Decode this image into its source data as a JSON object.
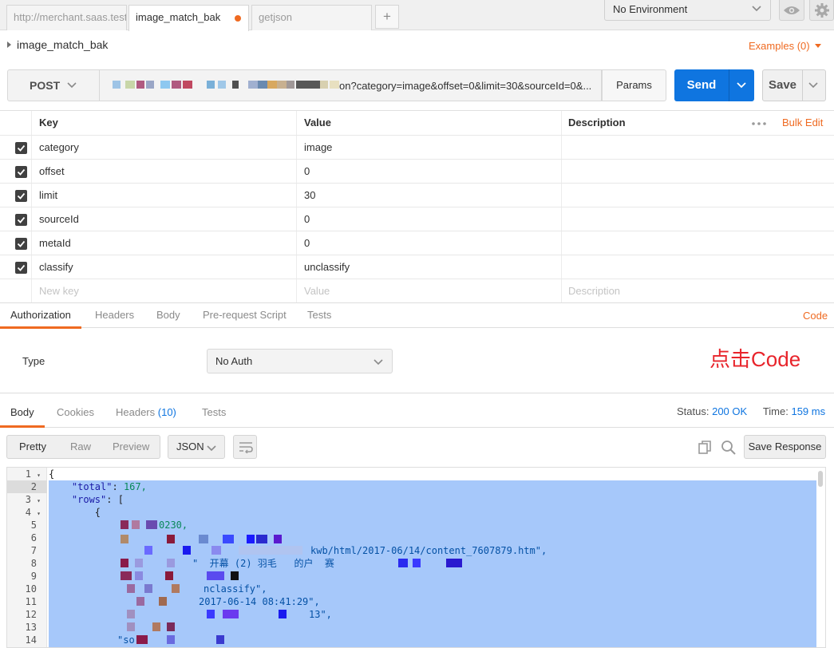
{
  "tabs": [
    {
      "label": "http://merchant.saas.test",
      "active": false
    },
    {
      "label": "image_match_bak",
      "active": true,
      "unsaved": true
    },
    {
      "label": "getjson",
      "active": false
    }
  ],
  "tab_add_label": "+",
  "environment": {
    "selected": "No Environment"
  },
  "request": {
    "name": "image_match_bak",
    "examples_label": "Examples (0)"
  },
  "url_bar": {
    "method": "POST",
    "url_visible_suffix": "on?category=image&offset=0&limit=30&sourceId=0&...",
    "params_label": "Params",
    "send_label": "Send",
    "save_label": "Save"
  },
  "params_table": {
    "headers": {
      "key": "Key",
      "value": "Value",
      "description": "Description"
    },
    "bulk_edit_label": "Bulk Edit",
    "rows": [
      {
        "key": "category",
        "value": "image",
        "description": ""
      },
      {
        "key": "offset",
        "value": "0",
        "description": ""
      },
      {
        "key": "limit",
        "value": "30",
        "description": ""
      },
      {
        "key": "sourceId",
        "value": "0",
        "description": ""
      },
      {
        "key": "metaId",
        "value": "0",
        "description": ""
      },
      {
        "key": "classify",
        "value": "unclassify",
        "description": ""
      }
    ],
    "new_row": {
      "key_placeholder": "New key",
      "value_placeholder": "Value",
      "description_placeholder": "Description"
    }
  },
  "request_tabs": [
    "Authorization",
    "Headers",
    "Body",
    "Pre-request Script",
    "Tests"
  ],
  "code_label": "Code",
  "auth": {
    "type_label": "Type",
    "type_value": "No Auth"
  },
  "annotation": "点击Code",
  "response": {
    "tabs": [
      "Body",
      "Cookies",
      "Headers",
      "Tests"
    ],
    "headers_count": "(10)",
    "status_label": "Status:",
    "status_value": "200 OK",
    "time_label": "Time:",
    "time_value": "159 ms",
    "view_modes": [
      "Pretty",
      "Raw",
      "Preview"
    ],
    "format": "JSON",
    "save_response_label": "Save Response",
    "line_numbers": [
      "1",
      "2",
      "3",
      "4",
      "5",
      "6",
      "7",
      "8",
      "9",
      "10",
      "11",
      "12",
      "13",
      "14"
    ],
    "code": {
      "l1": "{",
      "l2_key": "\"total\"",
      "l2_val": "167,",
      "l3_key": "\"rows\"",
      "l3_rest": ": [",
      "l4": "{",
      "l5": "0230,",
      "l7": "kwb/html/2017-06/14/content_7607879.htm\",",
      "l8": "\"  开幕 (2) 羽毛   的户  赛",
      "l10": "nclassify\",",
      "l11": "2017-06-14 08:41:29\",",
      "l12": "13\",",
      "l14": "\"so"
    }
  },
  "colors": {
    "accent": "#ef6a21",
    "send": "#0f75e0",
    "annotation": "#e8242b",
    "selection": "#a6c8fa"
  }
}
